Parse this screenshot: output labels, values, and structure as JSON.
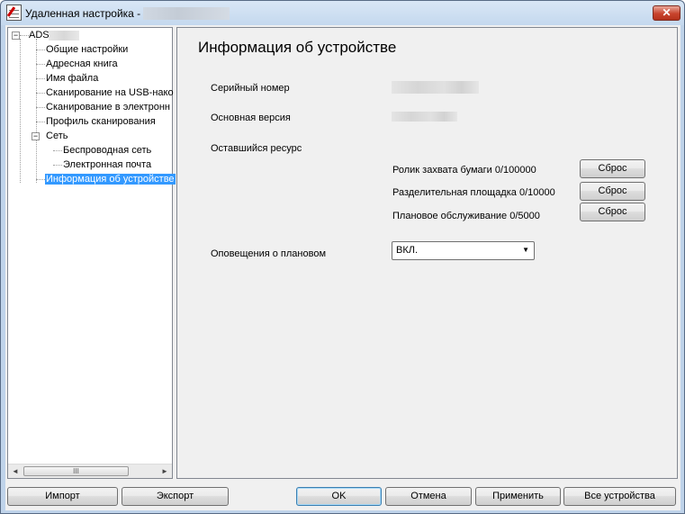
{
  "window": {
    "title": "Удаленная настройка -",
    "close_glyph": "✕"
  },
  "tree": {
    "root_label": "ADS",
    "items": [
      {
        "label": "Общие настройки"
      },
      {
        "label": "Адресная книга"
      },
      {
        "label": "Имя файла"
      },
      {
        "label": "Сканирование на USB-нако"
      },
      {
        "label": "Сканирование в электронн"
      },
      {
        "label": "Профиль сканирования"
      },
      {
        "label": "Сеть"
      },
      {
        "label": "Беспроводная сеть"
      },
      {
        "label": "Электронная почта"
      },
      {
        "label": "Информация об устройстве"
      }
    ],
    "scroll_left": "◄",
    "scroll_right": "►",
    "scroll_grip": "III"
  },
  "pane": {
    "title": "Информация об устройстве",
    "serial_label": "Серийный номер",
    "version_label": "Основная версия",
    "remaining_label": "Оставшийся ресурс",
    "resources": [
      {
        "label": "Ролик захвата бумаги 0/100000",
        "button": "Сброс"
      },
      {
        "label": "Разделительная площадка 0/10000",
        "button": "Сброс"
      },
      {
        "label": "Плановое обслуживание 0/5000",
        "button": "Сброс"
      }
    ],
    "notify_label": "Оповещения о плановом",
    "notify_value": "ВКЛ."
  },
  "footer": {
    "import": "Импорт",
    "export": "Экспорт",
    "ok": "OK",
    "cancel": "Отмена",
    "apply": "Применить",
    "all_devices": "Все устройства"
  }
}
